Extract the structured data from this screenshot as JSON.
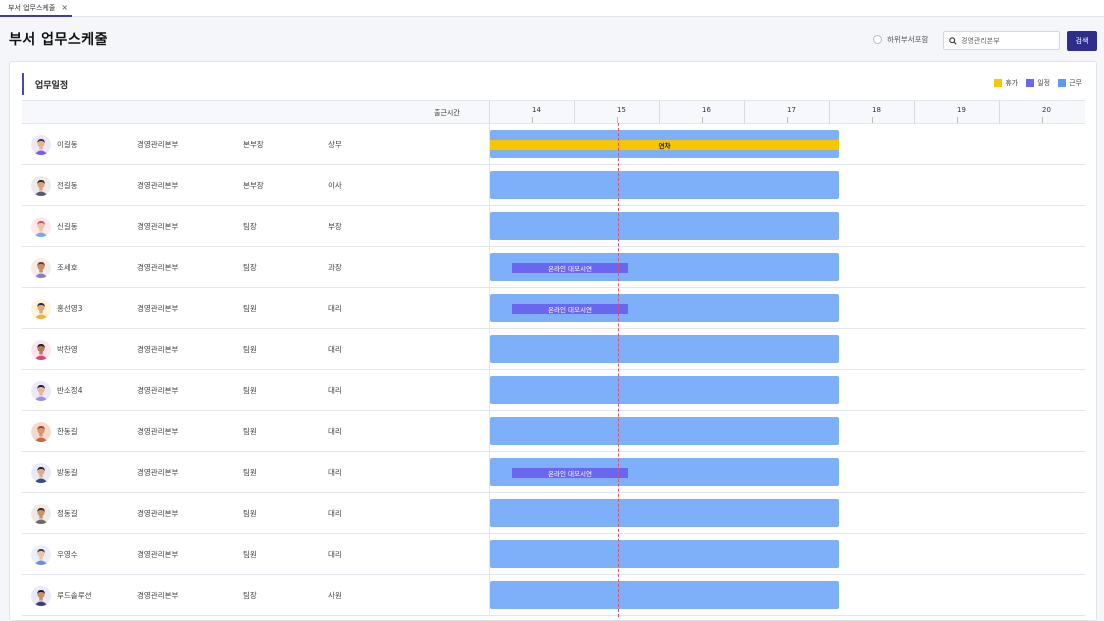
{
  "tab": {
    "label": "부서 업무스케줄",
    "close": "×"
  },
  "page": {
    "title": "부서 업무스케줄"
  },
  "filters": {
    "include_sub_label": "하위부서포함",
    "search_value": "경영관리본부",
    "search_button": "검색"
  },
  "panel": {
    "title": "업무일정"
  },
  "legend": [
    {
      "label": "휴가",
      "color": "#f7c600"
    },
    {
      "label": "일정",
      "color": "#6b66f0"
    },
    {
      "label": "근무",
      "color": "#5b9bf5"
    }
  ],
  "timeline": {
    "head_label": "출근시간",
    "hours": [
      "14",
      "15",
      "16",
      "17",
      "18",
      "19",
      "20"
    ],
    "work_bar_color": "#7eaff9",
    "now_line_color": "#e04e6a"
  },
  "rows": [
    {
      "name": "이길동",
      "dept": "경영관리본부",
      "role": "본부장",
      "rank": "상무",
      "event": {
        "type": "vacation",
        "label": "연차"
      },
      "avatar": {
        "bg": "#ede7f6",
        "skin": "#e9b48a",
        "hair": "#3a2a6a",
        "shirt": "#7a5cf0"
      }
    },
    {
      "name": "전길동",
      "dept": "경영관리본부",
      "role": "본부장",
      "rank": "이사",
      "event": null,
      "avatar": {
        "bg": "#efe9ea",
        "skin": "#d9a07a",
        "hair": "#2b2b2b",
        "shirt": "#5a5a6a"
      }
    },
    {
      "name": "신길동",
      "dept": "경영관리본부",
      "role": "팀장",
      "rank": "부장",
      "event": null,
      "avatar": {
        "bg": "#fbe9ec",
        "skin": "#f0c4a0",
        "hair": "#d94a5a",
        "shirt": "#7ea7e8"
      }
    },
    {
      "name": "조세호",
      "dept": "경영관리본부",
      "role": "팀장",
      "rank": "과장",
      "event": {
        "type": "schedule",
        "label": "온라인 대모시연"
      },
      "avatar": {
        "bg": "#f3ece7",
        "skin": "#c98c66",
        "hair": "#6a4030",
        "shirt": "#8a7ad0"
      }
    },
    {
      "name": "홍선영3",
      "dept": "경영관리본부",
      "role": "팀원",
      "rank": "대리",
      "event": {
        "type": "schedule",
        "label": "온라인 대모시연"
      },
      "avatar": {
        "bg": "#fff3d9",
        "skin": "#e0a87c",
        "hair": "#2a2a3a",
        "shirt": "#f2b23a"
      }
    },
    {
      "name": "박찬영",
      "dept": "경영관리본부",
      "role": "팀원",
      "rank": "대리",
      "event": null,
      "avatar": {
        "bg": "#fbe6ee",
        "skin": "#b87a58",
        "hair": "#1e1e2a",
        "shirt": "#e0457a"
      }
    },
    {
      "name": "반소정4",
      "dept": "경영관리본부",
      "role": "팀원",
      "rank": "대리",
      "event": null,
      "avatar": {
        "bg": "#ece8fa",
        "skin": "#e8b896",
        "hair": "#1f1f33",
        "shirt": "#9a8ef0"
      }
    },
    {
      "name": "한동길",
      "dept": "경영관리본부",
      "role": "팀원",
      "rank": "대리",
      "event": null,
      "avatar": {
        "bg": "#f4d9cf",
        "skin": "#d8956e",
        "hair": "#a0442e",
        "shirt": "#c46a4a"
      }
    },
    {
      "name": "방동길",
      "dept": "경영관리본부",
      "role": "팀원",
      "rank": "대리",
      "event": {
        "type": "schedule",
        "label": "온라인 대모시연"
      },
      "avatar": {
        "bg": "#e8ebf5",
        "skin": "#e1ad88",
        "hair": "#222233",
        "shirt": "#3c4a8a"
      }
    },
    {
      "name": "정동길",
      "dept": "경영관리본부",
      "role": "팀원",
      "rank": "대리",
      "event": null,
      "avatar": {
        "bg": "#efe9e4",
        "skin": "#c9906c",
        "hair": "#3a2a22",
        "shirt": "#6a6a72"
      }
    },
    {
      "name": "우영수",
      "dept": "경영관리본부",
      "role": "팀원",
      "rank": "대리",
      "event": null,
      "avatar": {
        "bg": "#e9eef8",
        "skin": "#f0c3a0",
        "hair": "#3a3a55",
        "shirt": "#6e8fd8"
      }
    },
    {
      "name": "루드솔루션",
      "dept": "경영관리본부",
      "role": "팀장",
      "rank": "사원",
      "event": null,
      "avatar": {
        "bg": "#e8eaf6",
        "skin": "#c9906c",
        "hair": "#1e1e2e",
        "shirt": "#3a3f7a"
      }
    }
  ]
}
